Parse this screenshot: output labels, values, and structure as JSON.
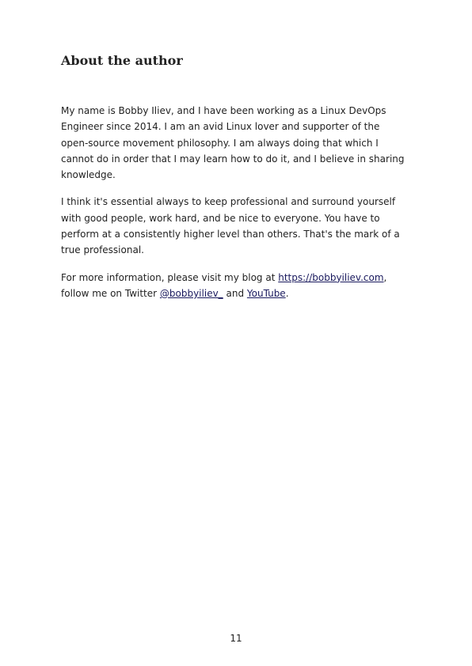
{
  "section": {
    "heading": "About the author"
  },
  "paragraphs": {
    "p1": [
      "My name is Bobby Iliev, and I have been working as a Linux DevOps",
      "Engineer since 2014. I am an avid Linux lover and supporter of the",
      "open-source movement philosophy. I am always doing that which I",
      "cannot do in order that I may learn how to do it, and I believe in sharing",
      "knowledge."
    ],
    "p2": [
      "I think it's essential always to keep professional and surround yourself",
      "with good people, work hard, and be nice to everyone. You have to",
      "perform at a consistently higher level than others. That's the mark of a",
      "true professional."
    ],
    "p3": {
      "line1_prefix": "For more information, please visit my blog at ",
      "blog_link": "https://bobbyiliev.com",
      "line1_suffix": ",",
      "line2_prefix": "follow me on Twitter ",
      "twitter_link": "@bobbyiliev_",
      "line2_middle": " and ",
      "youtube_link": "YouTube",
      "line2_suffix": "."
    }
  },
  "footer": {
    "page_number": "11"
  }
}
